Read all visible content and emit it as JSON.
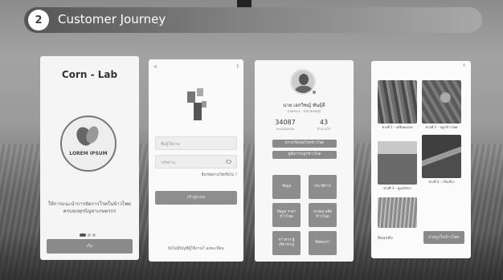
{
  "header": {
    "step_number": "2",
    "title": "Customer Journey"
  },
  "screen1": {
    "app_title": "Corn - Lab",
    "logo_text": "LOREM IPSUM",
    "tagline": "ให้การแนะนำการจัดการโรคในข้าวโพด ครบจบทุกปัญหาเกษตรกร",
    "button_label": "เริ่ม"
  },
  "screen2": {
    "back_glyph": "<",
    "username_placeholder": "ชื่อผู้ใช้งาน",
    "password_placeholder": "รหัสผ่าน",
    "forgot_label": "ลืมรหัสผ่านใช่หรือไม่ ?",
    "login_label": "เข้าสู่ระบบ",
    "signup_label": "ยังไม่มีบัญชีผู้ใช้งาน? ลงทะเบียน"
  },
  "screen3": {
    "name": "นาย เอกวิชญ์ พันธุ์ดี",
    "subtitle": "เกษตรกร · จังหวัดลพบุรี",
    "stats": [
      {
        "value": "34087",
        "label": "คะแนนสะสม"
      },
      {
        "value": "43",
        "label": "จำนวนไร่"
      }
    ],
    "bars": [
      "ตรวจวินิจฉัยโรคข้าวโพด",
      "คู่มือการปลูกข้าวโพด"
    ],
    "tiles": [
      "ข้อมูล",
      "ประวัติการ",
      "ข้อมูล ราคาข้าวโพด",
      "ขายผล ผลิตข้าวโพด",
      "ข่าวสาร ผู้เชี่ยวชาญ",
      "ติดต่อเรา"
    ]
  },
  "screen4": {
    "close_glyph": "×",
    "captions": [
      "ช่วงที่ 1 – เตรียมแปลง",
      "ช่วงที่ 2 – ปลูกข้าวโพด",
      "ช่วงที่ 3 – ดูแลรักษา",
      "ช่วงที่ 4 – เก็บเกี่ยว"
    ],
    "link_label": "ย้อนกลับ",
    "button_label": "ถ่ายรูปใบข้าวโพด"
  }
}
